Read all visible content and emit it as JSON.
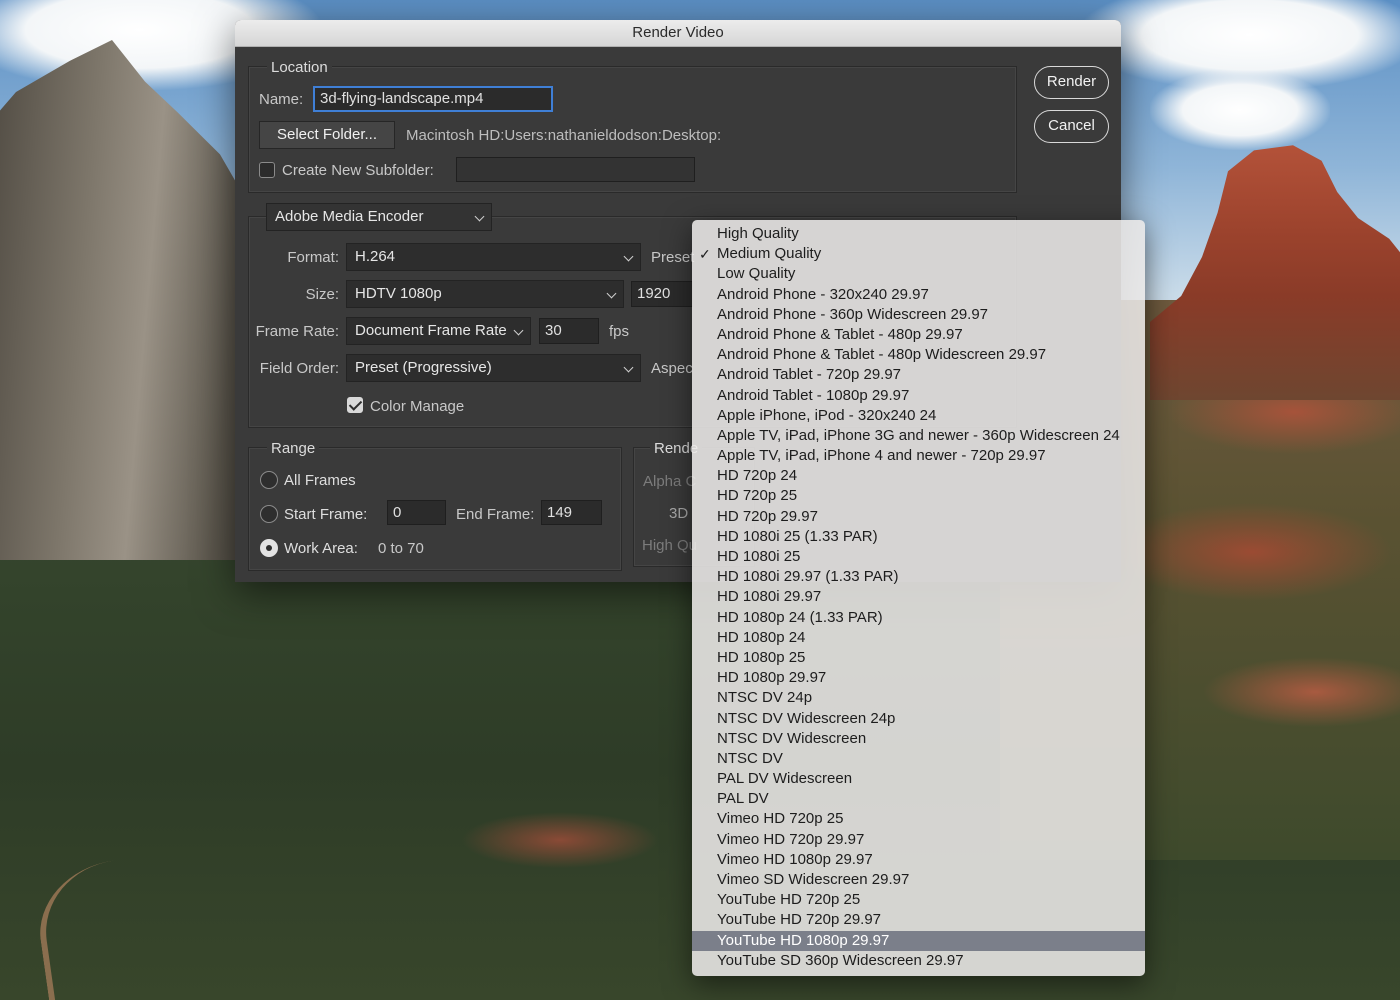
{
  "dialog": {
    "title": "Render Video",
    "location": {
      "group_title": "Location",
      "name_label": "Name:",
      "name_value": "3d-flying-landscape.mp4",
      "select_folder_label": "Select Folder...",
      "folder_path": "Macintosh HD:Users:nathanieldodson:Desktop:",
      "subfolder_label": "Create New Subfolder:",
      "subfolder_checked": false,
      "subfolder_value": ""
    },
    "render_button": "Render",
    "cancel_button": "Cancel",
    "encoder": {
      "selected": "Adobe Media Encoder",
      "format_label": "Format:",
      "format_value": "H.264",
      "preset_label_visible": "Preset",
      "size_label": "Size:",
      "size_value": "HDTV 1080p",
      "width_value": "1920",
      "frame_rate_label": "Frame Rate:",
      "frame_rate_value": "Document Frame Rate",
      "fps_value": "30",
      "fps_unit": "fps",
      "field_order_label": "Field Order:",
      "field_order_value": "Preset (Progressive)",
      "aspect_label_visible": "Aspec",
      "color_manage_label": "Color Manage",
      "color_manage_checked": true
    },
    "range": {
      "group_title": "Range",
      "all_frames_label": "All Frames",
      "start_frame_label": "Start Frame:",
      "start_frame_value": "0",
      "end_frame_label": "End Frame:",
      "end_frame_value": "149",
      "work_area_label": "Work Area:",
      "work_area_value": "0 to 70",
      "selected": "Work Area"
    },
    "render_options": {
      "group_title_visible": "Rende",
      "alpha_label_visible": "Alpha C",
      "three_d_label_visible": "3D",
      "high_quality_label_visible": "High Qu"
    }
  },
  "preset_menu": {
    "checked": "Medium Quality",
    "highlighted": "YouTube HD 1080p 29.97",
    "items": [
      "High Quality",
      "Medium Quality",
      "Low Quality",
      "Android Phone - 320x240 29.97",
      "Android Phone - 360p Widescreen 29.97",
      "Android Phone & Tablet - 480p 29.97",
      "Android Phone & Tablet - 480p Widescreen 29.97",
      "Android Tablet - 720p 29.97",
      "Android Tablet - 1080p 29.97",
      "Apple iPhone, iPod - 320x240 24",
      "Apple TV, iPad, iPhone 3G and newer - 360p Widescreen 24",
      "Apple TV, iPad, iPhone 4 and newer - 720p 29.97",
      "HD 720p 24",
      "HD 720p 25",
      "HD 720p 29.97",
      "HD 1080i 25 (1.33 PAR)",
      "HD 1080i 25",
      "HD 1080i 29.97 (1.33 PAR)",
      "HD 1080i 29.97",
      "HD 1080p 24 (1.33 PAR)",
      "HD 1080p 24",
      "HD 1080p 25",
      "HD 1080p 29.97",
      "NTSC DV 24p",
      "NTSC DV Widescreen 24p",
      "NTSC DV Widescreen",
      "NTSC DV",
      "PAL DV Widescreen",
      "PAL DV",
      "Vimeo HD 720p 25",
      "Vimeo HD 720p 29.97",
      "Vimeo HD 1080p 29.97",
      "Vimeo SD Widescreen 29.97",
      "YouTube HD 720p 25",
      "YouTube HD 720p 29.97",
      "YouTube HD 1080p 29.97",
      "YouTube SD 360p Widescreen 29.97"
    ]
  }
}
